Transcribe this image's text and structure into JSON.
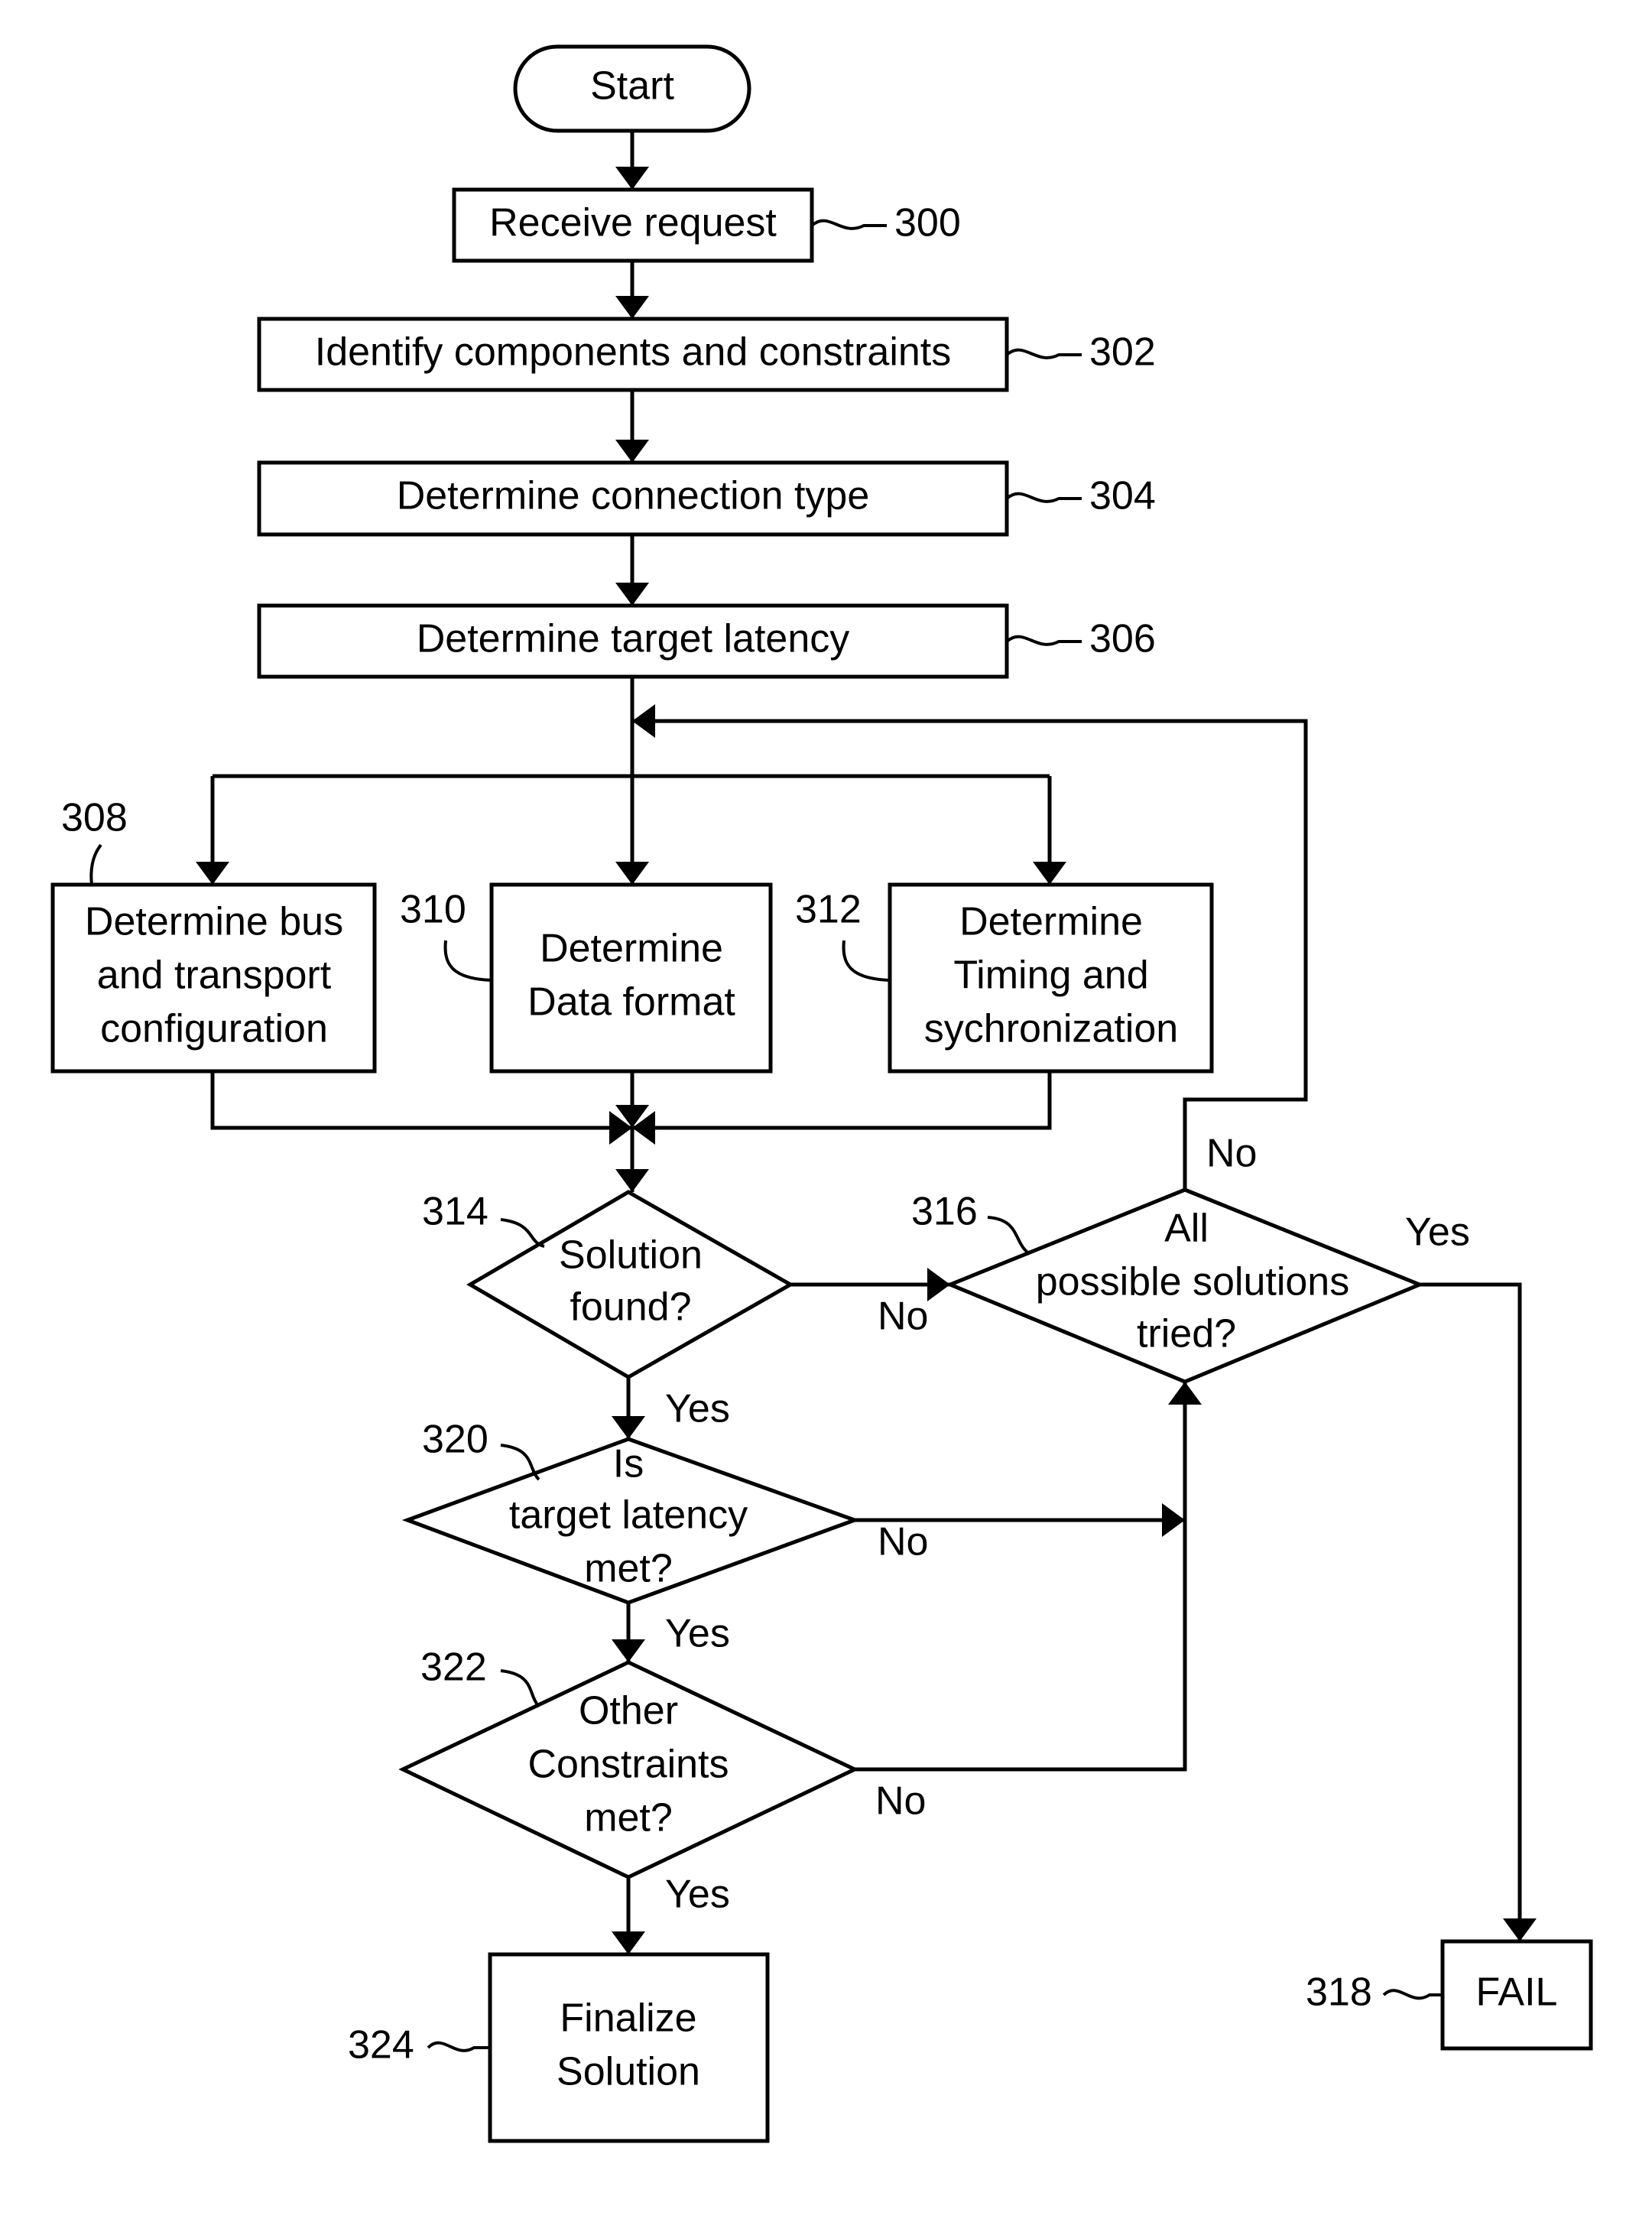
{
  "nodes": {
    "start": {
      "text": [
        "Start"
      ]
    },
    "n300": {
      "text": [
        "Receive request"
      ],
      "ref": "300"
    },
    "n302": {
      "text": [
        "Identify components and constraints"
      ],
      "ref": "302"
    },
    "n304": {
      "text": [
        "Determine connection type"
      ],
      "ref": "304"
    },
    "n306": {
      "text": [
        "Determine target latency"
      ],
      "ref": "306"
    },
    "n308": {
      "text": [
        "Determine bus",
        "and transport",
        "configuration"
      ],
      "ref": "308"
    },
    "n310": {
      "text": [
        "Determine",
        "Data format"
      ],
      "ref": "310"
    },
    "n312": {
      "text": [
        "Determine",
        "Timing and",
        "sychronization"
      ],
      "ref": "312"
    },
    "n314": {
      "text": [
        "Solution",
        "found?"
      ],
      "ref": "314"
    },
    "n316": {
      "text": [
        "All",
        "possible solutions",
        "tried?"
      ],
      "ref": "316"
    },
    "n318": {
      "text": [
        "FAIL"
      ],
      "ref": "318"
    },
    "n320": {
      "text": [
        "Is",
        "target latency",
        "met?"
      ],
      "ref": "320"
    },
    "n322": {
      "text": [
        "Other",
        "Constraints",
        "met?"
      ],
      "ref": "322"
    },
    "n324": {
      "text": [
        "Finalize",
        "Solution"
      ],
      "ref": "324"
    }
  },
  "edge_labels": {
    "n314_no": "No",
    "n314_yes": "Yes",
    "n316_no": "No",
    "n316_yes": "Yes",
    "n320_no": "No",
    "n320_yes": "Yes",
    "n322_no": "No",
    "n322_yes": "Yes"
  }
}
